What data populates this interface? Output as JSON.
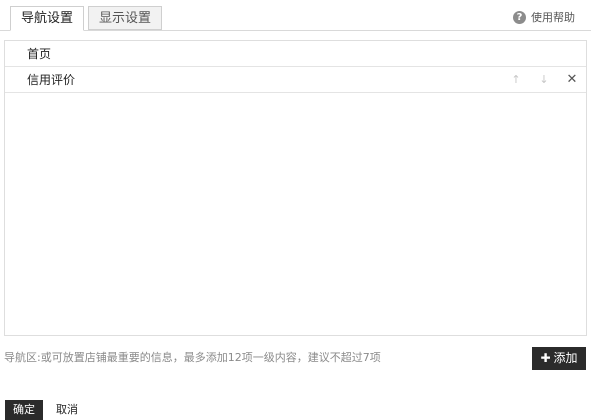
{
  "tabs": [
    {
      "label": "导航设置",
      "active": true
    },
    {
      "label": "显示设置",
      "active": false
    }
  ],
  "help": {
    "label": "使用帮助",
    "icon": "question-icon"
  },
  "nav_items": [
    {
      "label": "首页"
    },
    {
      "label": "信用评价"
    }
  ],
  "row_actions": {
    "up_icon": "arrow-up-icon",
    "down_icon": "arrow-down-icon",
    "close_icon": "close-icon"
  },
  "hint": "导航区:或可放置店铺最重要的信息，最多添加12项一级内容，建议不超过7项",
  "add_button": {
    "label": "添加",
    "icon": "plus-icon"
  },
  "footer": {
    "confirm": "确定",
    "cancel": "取消"
  }
}
